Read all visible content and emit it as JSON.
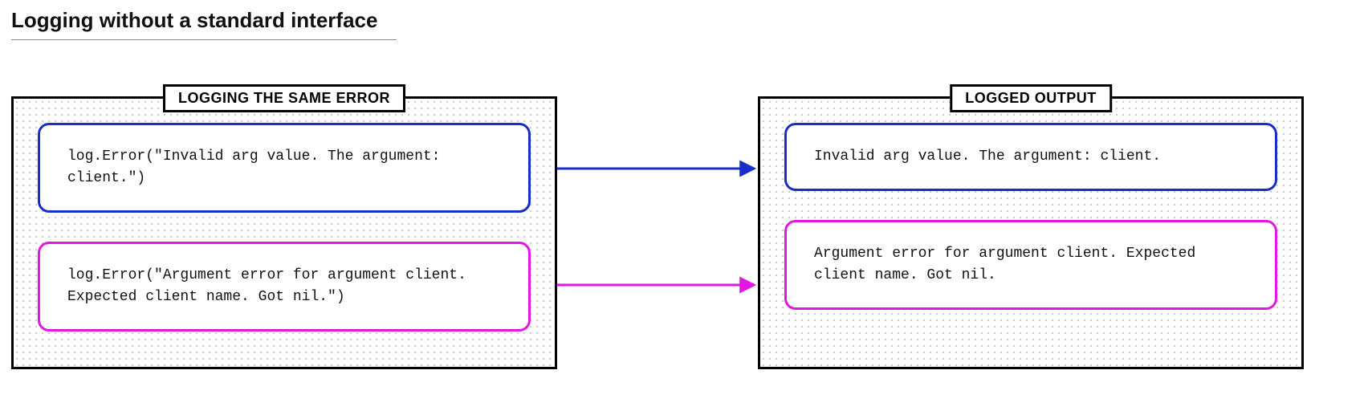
{
  "title": "Logging without a standard interface",
  "leftPanel": {
    "label": "LOGGING THE SAME ERROR",
    "cards": [
      {
        "color": "blue",
        "text": "log.Error(\"Invalid arg value. The argument: client.\")"
      },
      {
        "color": "magenta",
        "text": "log.Error(\"Argument error for argument client. Expected client name. Got nil.\")"
      }
    ]
  },
  "rightPanel": {
    "label": "LOGGED OUTPUT",
    "cards": [
      {
        "color": "blue",
        "text": "Invalid arg value. The argument: client."
      },
      {
        "color": "magenta",
        "text": "Argument error for argument client. Expected client name. Got nil."
      }
    ]
  },
  "colors": {
    "blue": "#192ec8",
    "magenta": "#e218e2"
  }
}
